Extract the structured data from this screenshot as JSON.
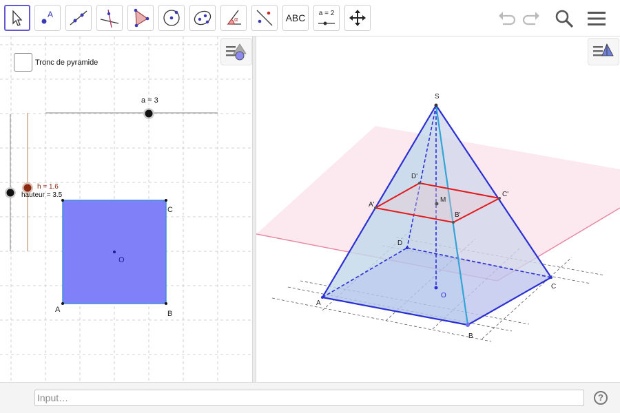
{
  "toolbar": {
    "tools": [
      {
        "name": "move-tool",
        "icon": "arrow-cursor-icon"
      },
      {
        "name": "point-tool",
        "icon": "point-icon",
        "letter": "A"
      },
      {
        "name": "line-tool",
        "icon": "line-icon"
      },
      {
        "name": "perpendicular-line-tool",
        "icon": "perpendicular-icon"
      },
      {
        "name": "polygon-tool",
        "icon": "polygon-icon"
      },
      {
        "name": "circle-tool",
        "icon": "circle-icon"
      },
      {
        "name": "ellipse-tool",
        "icon": "ellipse-icon"
      },
      {
        "name": "angle-tool",
        "icon": "angle-icon",
        "glyph": "α"
      },
      {
        "name": "reflect-tool",
        "icon": "reflect-icon"
      },
      {
        "name": "text-tool",
        "icon": "text-icon",
        "label": "ABC"
      },
      {
        "name": "slider-tool",
        "icon": "slider-icon",
        "label": "a = 2"
      },
      {
        "name": "move-graphics-tool",
        "icon": "move-graphics-icon"
      }
    ],
    "right": [
      "undo-icon",
      "redo-icon",
      "search-icon",
      "menu-icon"
    ],
    "accent_color": "#6557d2"
  },
  "algebra_view": {
    "checkbox": {
      "label": "Tronc de pyramide",
      "checked": false
    },
    "slider_a": {
      "label": "a = 3",
      "value": 3
    },
    "slider_h": {
      "label": "h = 1.6",
      "value": 1.6,
      "color": "#8b2a10"
    },
    "slider_hauteur": {
      "label": "hauteur = 3.5",
      "value": 3.5
    },
    "square": {
      "fill": "#8080f8",
      "stroke": "#3b8fd9"
    },
    "points": {
      "A": "A",
      "B": "B",
      "C": "C",
      "O": "O"
    }
  },
  "graphics3d": {
    "labels": {
      "S": "S",
      "A": "A",
      "B": "B",
      "C": "C",
      "D": "D",
      "O": "O",
      "M": "M",
      "A1": "A'",
      "B1": "B'",
      "C1": "C'",
      "D1": "D'"
    },
    "colors": {
      "edges": "#2b2fd3",
      "section": "#e11b1b",
      "plane": "#f4a6c0",
      "base": "#8d91f0"
    }
  },
  "input_bar": {
    "placeholder": "Input…",
    "help": "?"
  }
}
